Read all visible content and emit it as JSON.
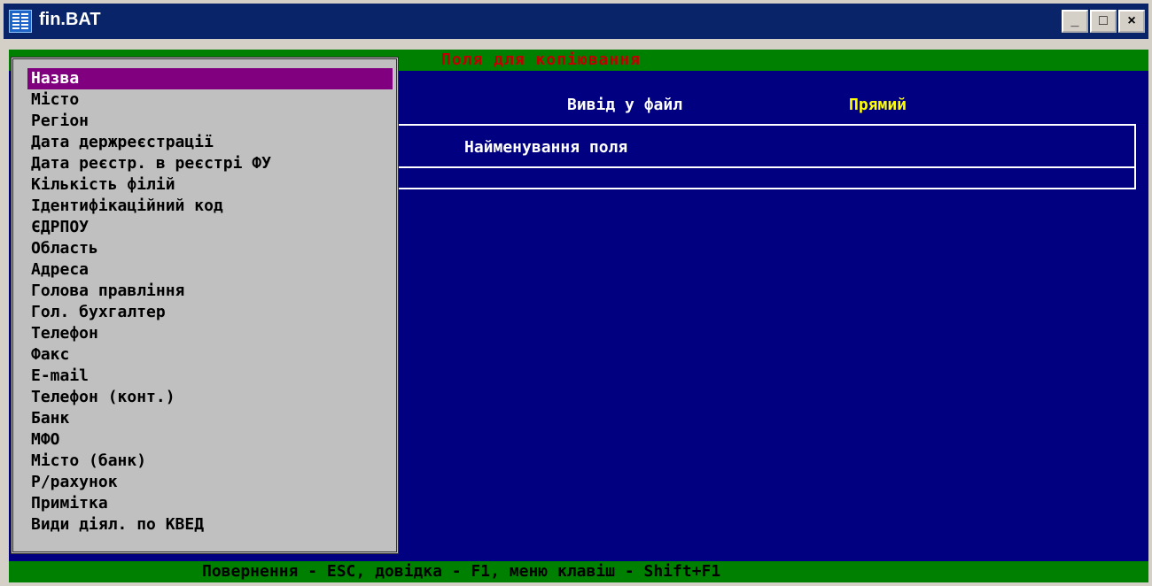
{
  "window": {
    "title": "fin.BAT",
    "buttons": {
      "minimize": "_",
      "maximize": "□",
      "close": "×"
    }
  },
  "console": {
    "top_bar_title": "Поля для копіювання",
    "output_label": "Вивід у файл",
    "output_value": "Прямий",
    "field_header": "Найменування поля",
    "status_bar": "Повернення - ESC, довідка - F1, меню клавіш - Shift+F1",
    "fields": [
      {
        "label": "Назва",
        "selected": true
      },
      {
        "label": "Місто"
      },
      {
        "label": "Регіон"
      },
      {
        "label": "Дата держреєстрації"
      },
      {
        "label": "Дата реєстр. в реєстрі ФУ"
      },
      {
        "label": "Кількість філій"
      },
      {
        "label": "Ідентифікаційний код"
      },
      {
        "label": "ЄДРПОУ"
      },
      {
        "label": "Область"
      },
      {
        "label": "Адреса"
      },
      {
        "label": "Голова правління"
      },
      {
        "label": "Гол. бухгалтер"
      },
      {
        "label": "Телефон"
      },
      {
        "label": "Факс"
      },
      {
        "label": "E-mail"
      },
      {
        "label": "Телефон (конт.)"
      },
      {
        "label": "Банк"
      },
      {
        "label": "МФО"
      },
      {
        "label": "Місто (банк)"
      },
      {
        "label": "Р/рахунок"
      },
      {
        "label": "Примітка"
      },
      {
        "label": "Види діял. по КВЕД"
      }
    ]
  },
  "colors": {
    "console_bg": "#000080",
    "bar_bg": "#008000",
    "list_bg": "#c0c0c0",
    "selection_bg": "#800080",
    "top_title_color": "#c00000",
    "output_value_color": "#ffff00"
  }
}
